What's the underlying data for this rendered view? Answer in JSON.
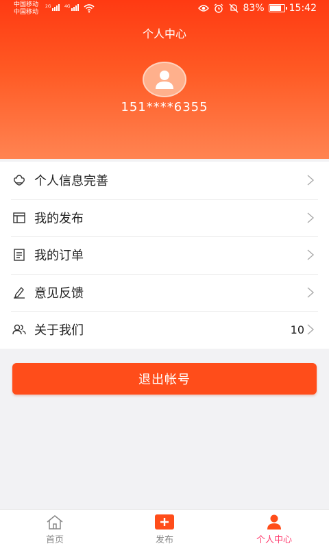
{
  "status_bar": {
    "carrier_1": "中国移动",
    "carrier_2": "中国移动",
    "net_1": "2G",
    "net_2": "4G",
    "battery_text": "83%",
    "battery_level": 0.83,
    "time": "15:42"
  },
  "header": {
    "title": "个人中心",
    "phone": "151****6355"
  },
  "menu": {
    "items": [
      {
        "label": "个人信息完善",
        "icon": "user-edit-icon",
        "value": ""
      },
      {
        "label": "我的发布",
        "icon": "publish-list-icon",
        "value": ""
      },
      {
        "label": "我的订单",
        "icon": "order-icon",
        "value": ""
      },
      {
        "label": "意见反馈",
        "icon": "feedback-icon",
        "value": ""
      },
      {
        "label": "关于我们",
        "icon": "about-us-icon",
        "value": "10"
      }
    ]
  },
  "logout_label": "退出帐号",
  "tabbar": {
    "tabs": [
      {
        "label": "首页",
        "icon": "home-icon",
        "active": false
      },
      {
        "label": "发布",
        "icon": "plus-icon",
        "active": false
      },
      {
        "label": "个人中心",
        "icon": "user-icon",
        "active": true
      }
    ]
  },
  "colors": {
    "accent": "#ff4d1a",
    "active_tab": "#ff3c6e"
  }
}
